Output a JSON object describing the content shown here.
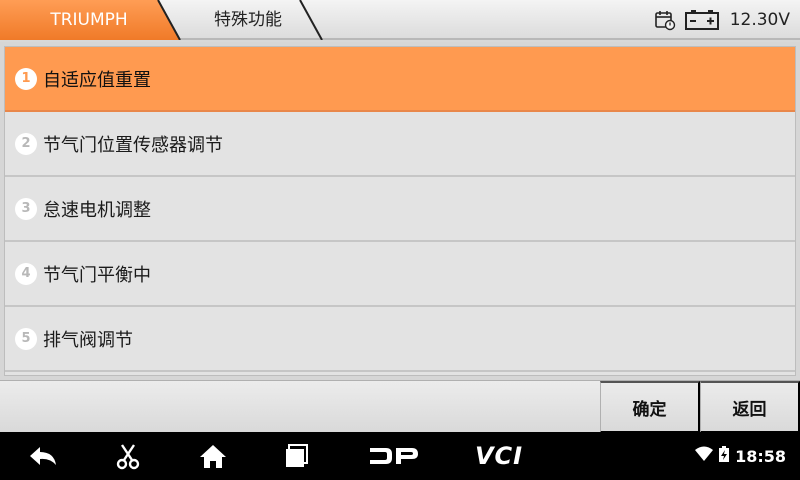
{
  "header": {
    "breadcrumb_1": "TRIUMPH",
    "breadcrumb_2": "特殊功能",
    "voltage": "12.30V",
    "accent_color": "#ff8a3a"
  },
  "list": {
    "items": [
      {
        "number": "1",
        "label": "自适应值重置",
        "selected": true
      },
      {
        "number": "2",
        "label": "节气门位置传感器调节"
      },
      {
        "number": "3",
        "label": "怠速电机调整"
      },
      {
        "number": "4",
        "label": "节气门平衡中"
      },
      {
        "number": "5",
        "label": "排气阀调节"
      }
    ]
  },
  "footer": {
    "confirm_label": "确定",
    "back_label": "返回"
  },
  "navbar": {
    "dp_label": "DP",
    "vci_label": "VCI",
    "clock": "18:58"
  }
}
